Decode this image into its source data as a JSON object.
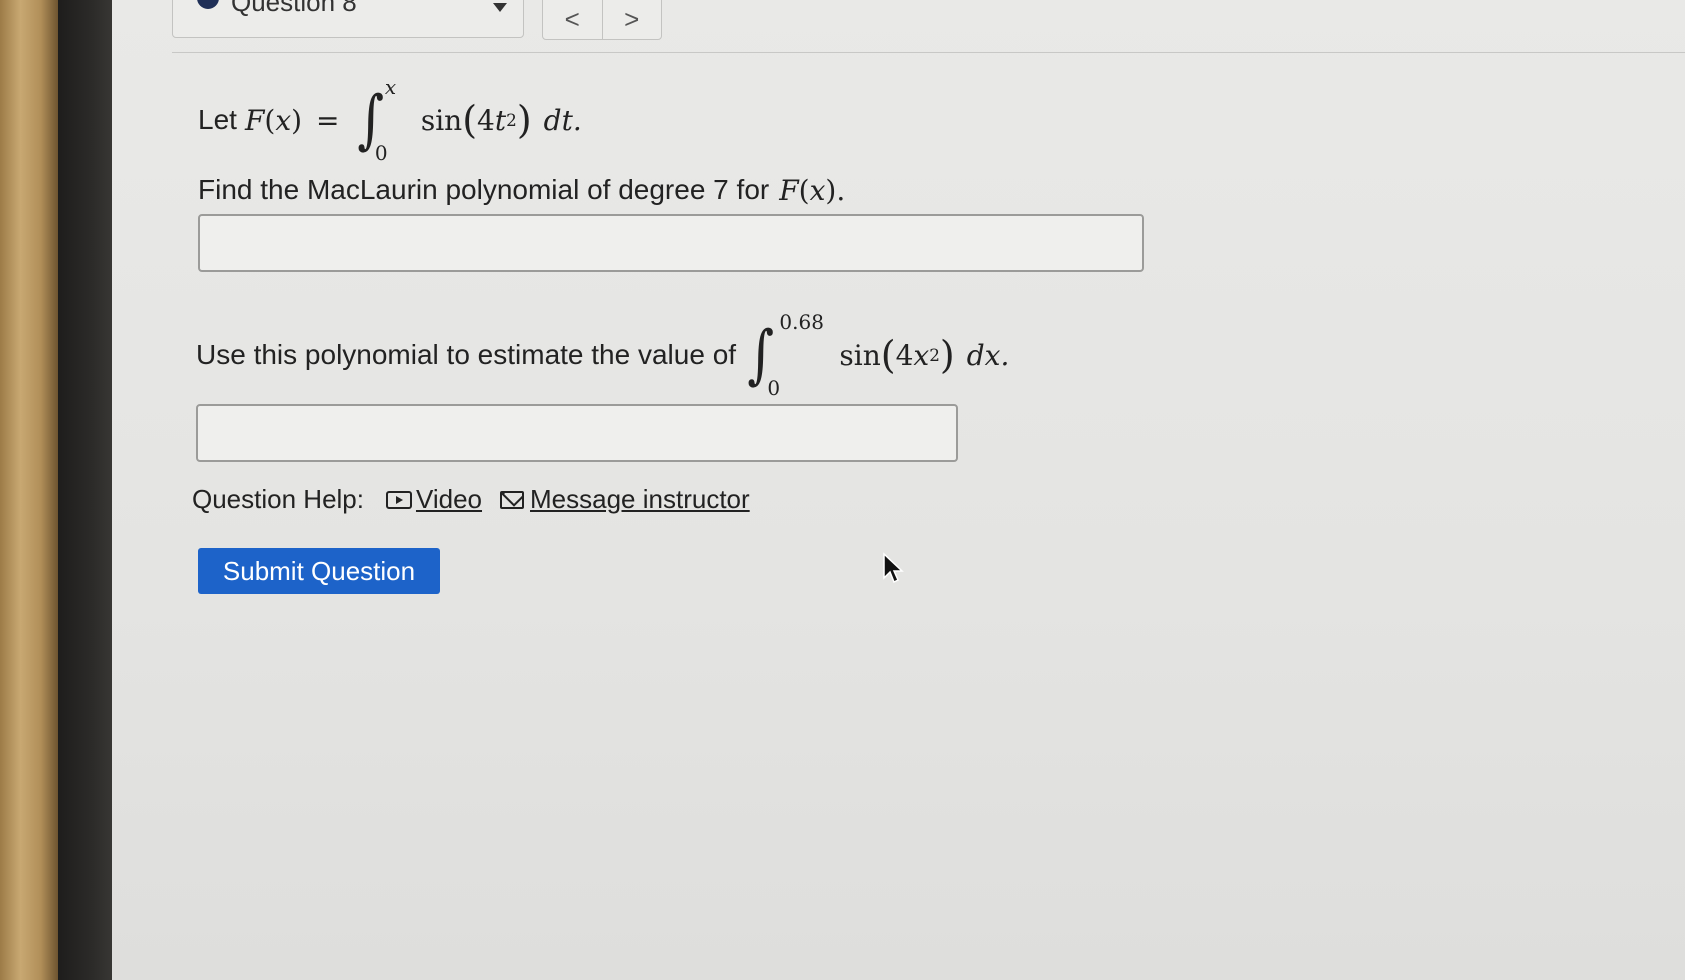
{
  "question_selector": {
    "label": "Question 8"
  },
  "nav": {
    "prev": "<",
    "next": ">"
  },
  "problem": {
    "intro_text": "Let",
    "func_name": "F",
    "func_arg": "x",
    "equals": "=",
    "integral_upper": "x",
    "integral_lower": "0",
    "integrand_fn": "sin",
    "integrand_coef": "4",
    "integrand_var": "t",
    "integrand_exp": "2",
    "differential": "dt.",
    "part1_text": "Find the MacLaurin polynomial of degree 7 for",
    "part1_func": "F",
    "part1_arg": "x",
    "part1_tail": ").",
    "part2_text": "Use this polynomial to estimate the value of",
    "int2_upper": "0.68",
    "int2_lower": "0",
    "int2_fn": "sin",
    "int2_coef": "4",
    "int2_var": "x",
    "int2_exp": "2",
    "int2_differential": "dx."
  },
  "answer1": {
    "value": ""
  },
  "answer2": {
    "value": ""
  },
  "help": {
    "label": "Question Help:",
    "video": "Video",
    "message": "Message instructor"
  },
  "submit": {
    "label": "Submit Question"
  },
  "colors": {
    "submit_bg": "#1d63c9",
    "dot": "#1f2f57"
  }
}
